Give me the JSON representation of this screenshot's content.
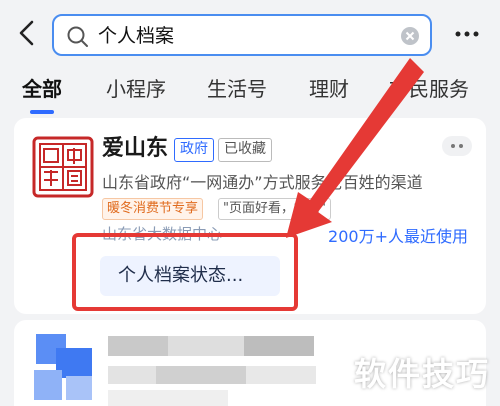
{
  "search": {
    "query": "个人档案"
  },
  "tabs": [
    {
      "label": "全部",
      "active": true
    },
    {
      "label": "小程序",
      "active": false
    },
    {
      "label": "生活号",
      "active": false
    },
    {
      "label": "理财",
      "active": false
    },
    {
      "label": "市民服务",
      "active": false
    }
  ],
  "result": {
    "name": "爱山东",
    "badges": [
      "政府",
      "已收藏"
    ],
    "description": "山东省政府“一网通办”方式服务老百姓的渠道",
    "tags": [
      "暖冬消费节专享",
      "\"页面好看，好用\""
    ],
    "organization": "山东省大数据中心",
    "usage": "200万+人最近使用",
    "logo_text": "中國"
  },
  "suggestion": {
    "label": "个人档案状态..."
  },
  "watermark": "软件技巧",
  "colors": {
    "accent": "#2f6bff",
    "highlight": "#e53935",
    "promo": "#e06b1e"
  }
}
